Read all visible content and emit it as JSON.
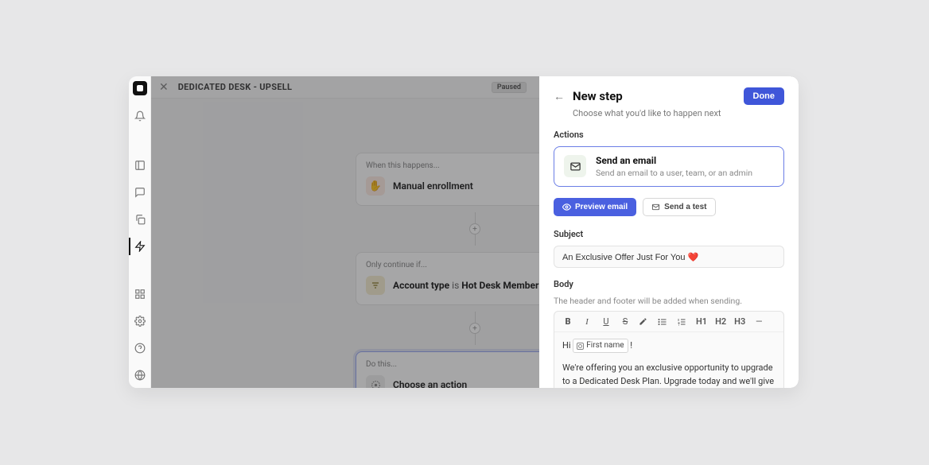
{
  "header": {
    "breadcrumb": "DEDICATED DESK - UPSELL",
    "status": "Paused"
  },
  "flow": {
    "trigger": {
      "label": "When this happens...",
      "title": "Manual enrollment"
    },
    "condition": {
      "label": "Only continue if...",
      "field": "Account type",
      "verb": "is",
      "value": "Hot Desk Member"
    },
    "action": {
      "label": "Do this...",
      "title": "Choose an action"
    }
  },
  "panel": {
    "title": "New step",
    "subtitle": "Choose what you'd like to happen next",
    "done": "Done",
    "actions_label": "Actions",
    "action": {
      "title": "Send an email",
      "desc": "Send an email to a user, team, or an admin"
    },
    "buttons": {
      "preview": "Preview email",
      "test": "Send a test"
    },
    "subject_label": "Subject",
    "subject_value": "An Exclusive Offer Just For You ❤️",
    "body_label": "Body",
    "body_help": "The header and footer will be added when sending.",
    "toolbar": {
      "b": "B",
      "i": "I",
      "u": "U",
      "s": "S",
      "h1": "H1",
      "h2": "H2",
      "h3": "H3"
    },
    "body": {
      "greeting_prefix": "Hi ",
      "token": "First name",
      "greeting_suffix": " !",
      "paragraph": "We're offering you an exclusive opportunity to upgrade to a Dedicated Desk Plan. Upgrade today and we'll give you one month free!"
    }
  }
}
